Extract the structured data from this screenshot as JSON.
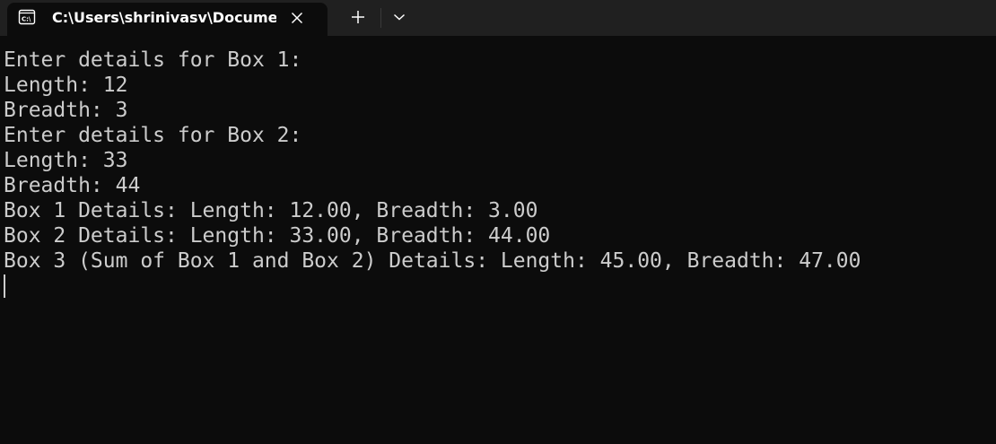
{
  "tab": {
    "title": "C:\\Users\\shrinivasv\\Documen",
    "icon": "console-icon"
  },
  "toolbar": {
    "close_icon": "close-icon",
    "new_tab_icon": "plus-icon",
    "dropdown_icon": "chevron-down-icon"
  },
  "terminal": {
    "lines": [
      "Enter details for Box 1:",
      "Length: 12",
      "Breadth: 3",
      "Enter details for Box 2:",
      "Length: 33",
      "Breadth: 44",
      "Box 1 Details: Length: 12.00, Breadth: 3.00",
      "Box 2 Details: Length: 33.00, Breadth: 44.00",
      "Box 3 (Sum of Box 1 and Box 2) Details: Length: 45.00, Breadth: 47.00"
    ]
  },
  "colors": {
    "background": "#0c0c0c",
    "tabbar": "#202020",
    "text": "#cccccc",
    "title": "#ffffff"
  }
}
